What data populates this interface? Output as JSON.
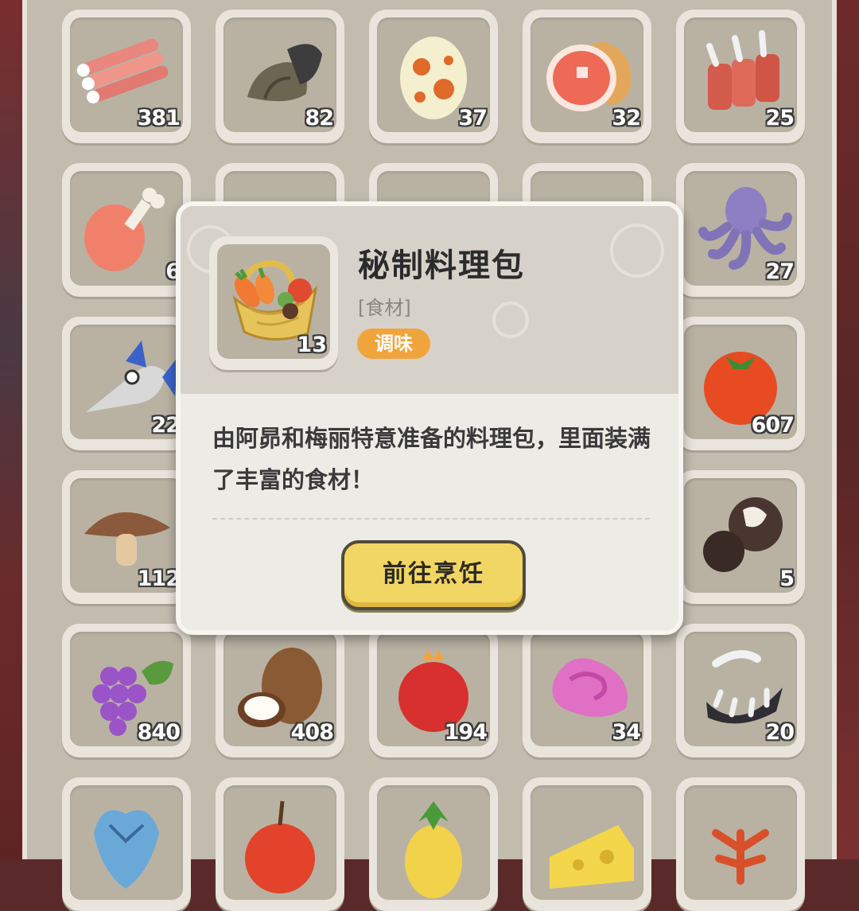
{
  "inventory": {
    "slots": [
      {
        "icon": "meat-ribs-icon",
        "count": "381"
      },
      {
        "icon": "hooves-icon",
        "count": "82"
      },
      {
        "icon": "egg-icon",
        "count": "37"
      },
      {
        "icon": "ham-icon",
        "count": "32"
      },
      {
        "icon": "claw-meat-icon",
        "count": "25"
      },
      {
        "icon": "drumstick-icon",
        "count": "6"
      },
      {
        "icon": "hidden-item-icon",
        "count": ""
      },
      {
        "icon": "hidden-item-icon",
        "count": ""
      },
      {
        "icon": "hidden-item-icon",
        "count": ""
      },
      {
        "icon": "octopus-icon",
        "count": "27"
      },
      {
        "icon": "swordfish-icon",
        "count": "22"
      },
      {
        "icon": "hidden-item-icon",
        "count": ""
      },
      {
        "icon": "hidden-item-icon",
        "count": ""
      },
      {
        "icon": "hidden-item-icon",
        "count": ""
      },
      {
        "icon": "tomato-icon",
        "count": "607"
      },
      {
        "icon": "mushroom-icon",
        "count": "112"
      },
      {
        "icon": "hidden-item-icon",
        "count": ""
      },
      {
        "icon": "hidden-item-icon",
        "count": ""
      },
      {
        "icon": "hidden-item-icon",
        "count": ""
      },
      {
        "icon": "truffle-icon",
        "count": "5"
      },
      {
        "icon": "grapes-icon",
        "count": "840"
      },
      {
        "icon": "coconut-icon",
        "count": "408"
      },
      {
        "icon": "pomegranate-icon",
        "count": "194"
      },
      {
        "icon": "pink-tentacle-icon",
        "count": "34"
      },
      {
        "icon": "fang-jaw-icon",
        "count": "20"
      },
      {
        "icon": "crystal-heart-icon",
        "count": ""
      },
      {
        "icon": "apple-icon",
        "count": ""
      },
      {
        "icon": "pineapple-icon",
        "count": ""
      },
      {
        "icon": "cheese-icon",
        "count": ""
      },
      {
        "icon": "red-leaf-icon",
        "count": ""
      }
    ]
  },
  "popup": {
    "name": "秘制料理包",
    "category": "[食材]",
    "tag": "调味",
    "count": "13",
    "icon": "basket-icon",
    "description": "由阿昴和梅丽特意准备的料理包，里面装满了丰富的食材！",
    "action_label": "前往烹饪"
  },
  "colors": {
    "panel_bg": "#c2bcae",
    "tag_orange": "#f0a43c",
    "button_yellow": "#f2d663"
  }
}
